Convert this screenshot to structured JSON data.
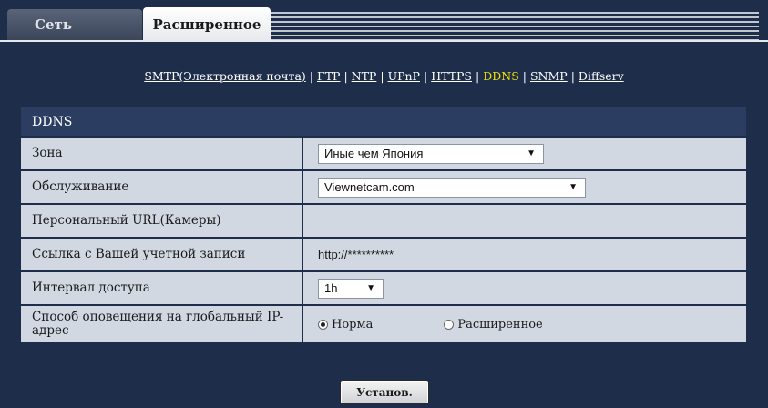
{
  "tabs": {
    "network": "Сеть",
    "advanced": "Расширенное"
  },
  "links": {
    "smtp": "SMTP(Электронная почта)",
    "ftp": "FTP",
    "ntp": "NTP",
    "upnp": "UPnP",
    "https": "HTTPS",
    "ddns": "DDNS",
    "snmp": "SNMP",
    "diffserv": "Diffserv",
    "separator": "|",
    "current": "DDNS"
  },
  "panel": {
    "title": "DDNS",
    "rows": {
      "zone": {
        "label": "Зона",
        "value": "Иные чем Япония"
      },
      "service": {
        "label": "Обслуживание",
        "value": "Viewnetcam.com"
      },
      "personal_url": {
        "label": "Персональный URL(Камеры)",
        "value": ""
      },
      "account_link": {
        "label": "Ссылка с Вашей учетной записи",
        "value": "http://**********"
      },
      "access_interval": {
        "label": "Интервал доступа",
        "value": "1h"
      },
      "notify_method": {
        "label": "Способ оповещения на глобальный IP-адрес",
        "options": [
          "Норма",
          "Расширенное"
        ],
        "selected": "Норма"
      }
    }
  },
  "buttons": {
    "set": "Установ."
  },
  "colors": {
    "background": "#1e2e4a",
    "row_bg": "#d1d8e2",
    "header_bg": "#2b3e62",
    "active_link": "#f2e300"
  },
  "icons": {
    "dropdown": "chevron-down-icon",
    "radio": "radio-icon"
  }
}
